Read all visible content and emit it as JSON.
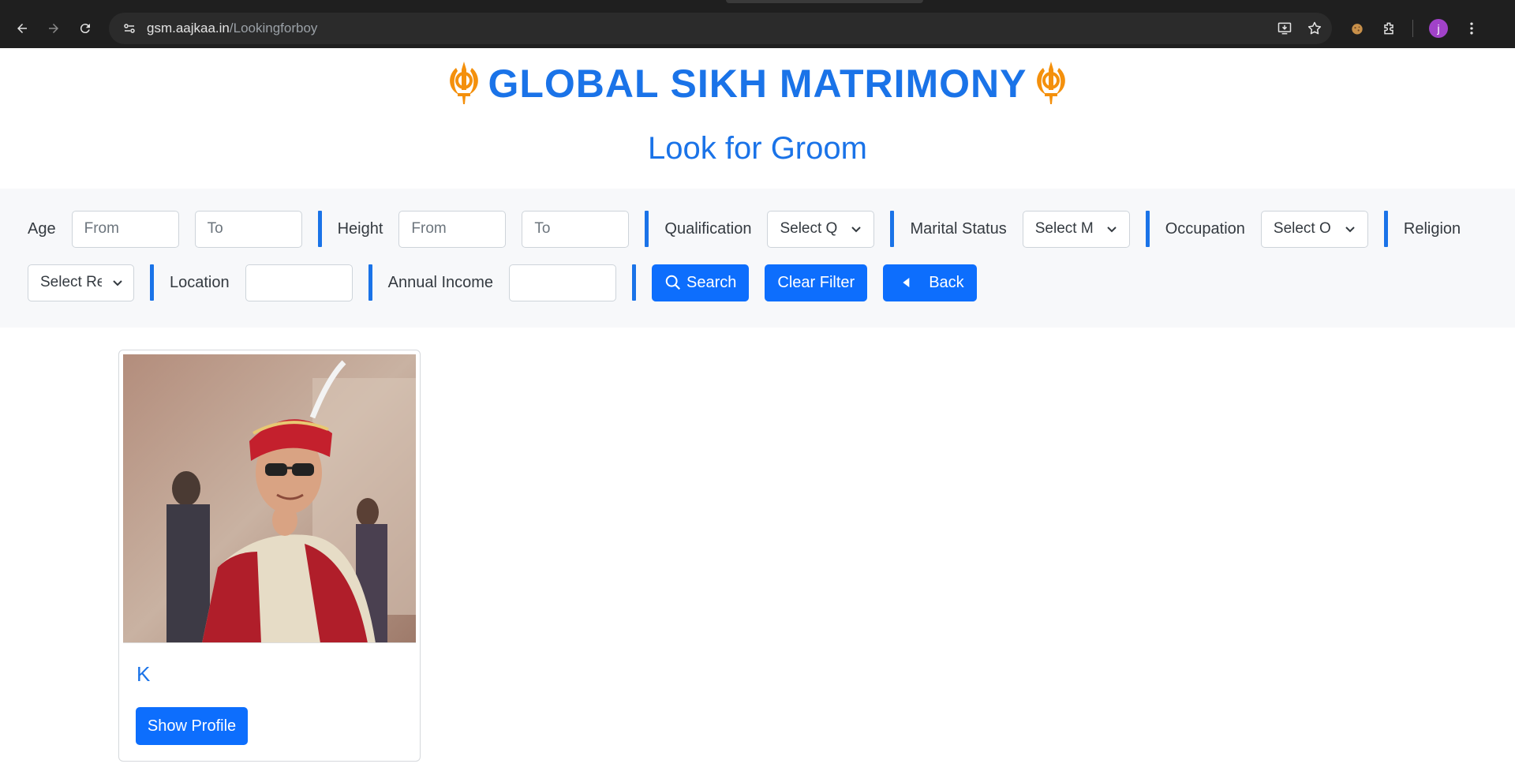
{
  "browser": {
    "url_host": "gsm.aajkaa.in",
    "url_path": "/Lookingforboy",
    "avatar_letter": "j"
  },
  "site": {
    "title": "GLOBAL SIKH MATRIMONY",
    "accent": "#1a73e8",
    "emblem_color": "#f4900c"
  },
  "page": {
    "heading": "Look for Groom"
  },
  "filters": {
    "age_label": "Age",
    "age_from_placeholder": "From",
    "age_to_placeholder": "To",
    "height_label": "Height",
    "height_from_placeholder": "From",
    "height_to_placeholder": "To",
    "qualification_label": "Qualification",
    "qualification_value": "Select Q",
    "marital_label": "Marital Status",
    "marital_value": "Select M",
    "occupation_label": "Occupation",
    "occupation_value": "Select O",
    "religion_label": "Religion",
    "religion_value": "Select Re",
    "location_label": "Location",
    "location_value": "",
    "income_label": "Annual Income",
    "income_value": "",
    "search_label": "Search",
    "clear_label": "Clear Filter",
    "back_label": "Back"
  },
  "results": [
    {
      "name": "K",
      "button_label": "Show Profile"
    }
  ]
}
